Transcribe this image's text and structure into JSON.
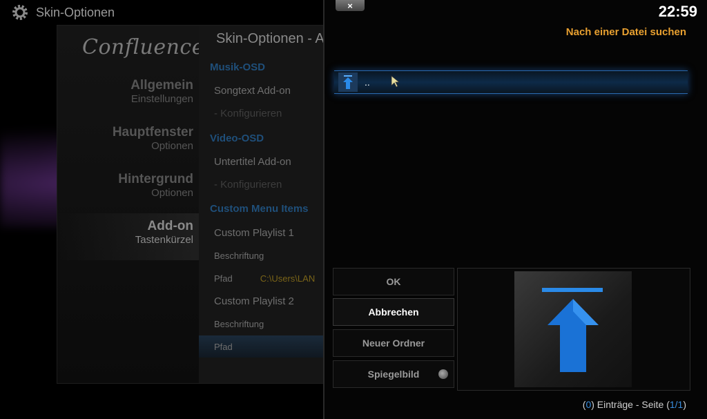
{
  "header": {
    "title": "Skin-Optionen"
  },
  "logo": "Confluence",
  "menu": [
    {
      "title": "Allgemein",
      "subtitle": "Einstellungen"
    },
    {
      "title": "Hauptfenster",
      "subtitle": "Optionen"
    },
    {
      "title": "Hintergrund",
      "subtitle": "Optionen"
    },
    {
      "title": "Add-on",
      "subtitle": "Tastenkürzel"
    }
  ],
  "options": {
    "title": "Skin-Optionen - A",
    "rows": [
      {
        "label": "Musik-OSD"
      },
      {
        "label": "Songtext Add-on"
      },
      {
        "label": "- Konfigurieren"
      },
      {
        "label": "Video-OSD"
      },
      {
        "label": "Untertitel Add-on"
      },
      {
        "label": "- Konfigurieren"
      },
      {
        "label": "Custom Menu Items"
      },
      {
        "label": "Custom Playlist 1"
      },
      {
        "label": "Beschriftung"
      },
      {
        "label": "Pfad",
        "value": "C:\\Users\\LAN"
      },
      {
        "label": "Custom Playlist 2"
      },
      {
        "label": "Beschriftung"
      },
      {
        "label": "Pfad"
      }
    ]
  },
  "dialog": {
    "close_label": "×",
    "clock": "22:59",
    "title": "Nach einer Datei suchen",
    "file_item": "..",
    "buttons": {
      "ok": "OK",
      "cancel": "Abbrechen",
      "new_folder": "Neuer Ordner",
      "mirror": "Spiegelbild"
    },
    "footer": {
      "open": "(",
      "count": "0",
      "mid": ") Einträge - Seite (",
      "page": "1/1",
      "close": ")"
    }
  },
  "colors": {
    "accent_blue": "#2a7ae0",
    "title_orange": "#e8a030",
    "section_blue": "#1f4f7a"
  }
}
